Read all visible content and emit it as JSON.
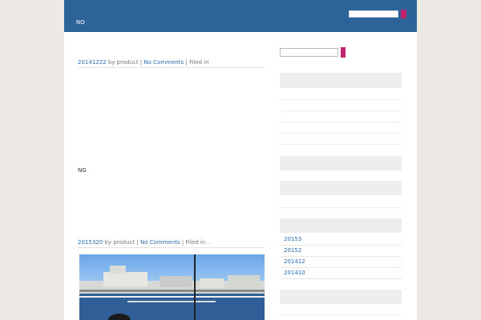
{
  "header": {
    "nav_label": "NO"
  },
  "posts": [
    {
      "date": "20141222",
      "by": "by product |",
      "comments": "No Comments",
      "filed": "| Filed in",
      "body": "NG"
    },
    {
      "date": "2015320",
      "by": "by product |",
      "comments": "No Comments",
      "filed": "| Filed in ."
    }
  ],
  "sidebar": {
    "archives": [
      "20153",
      "20152",
      "201412",
      "201410"
    ]
  },
  "colors": {
    "header": "#2c6499",
    "accent_button": "#c0236e",
    "link": "#2a6cb2",
    "background": "#ece8e3"
  }
}
